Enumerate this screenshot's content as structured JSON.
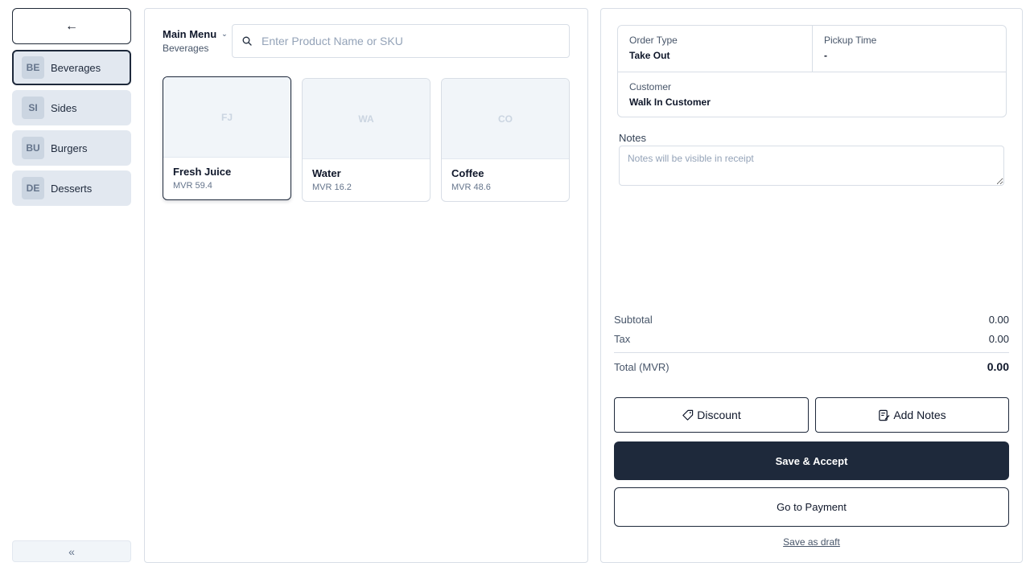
{
  "sidebar": {
    "back_icon": "arrow-left-icon",
    "back_glyph": "←",
    "categories": [
      {
        "badge": "BE",
        "label": "Beverages",
        "active": true
      },
      {
        "badge": "SI",
        "label": "Sides",
        "active": false
      },
      {
        "badge": "BU",
        "label": "Burgers",
        "active": false
      },
      {
        "badge": "DE",
        "label": "Desserts",
        "active": false
      }
    ],
    "collapse_glyph": "«",
    "collapse_icon": "chevrons-left-icon"
  },
  "menu": {
    "title": "Main Menu",
    "subtitle": "Beverages",
    "chevron_glyph": "⌄"
  },
  "search": {
    "placeholder": "Enter Product Name or SKU",
    "value": ""
  },
  "products": [
    {
      "initials": "FJ",
      "name": "Fresh Juice",
      "price": "MVR 59.4",
      "selected": true
    },
    {
      "initials": "WA",
      "name": "Water",
      "price": "MVR 16.2",
      "selected": false
    },
    {
      "initials": "CO",
      "name": "Coffee",
      "price": "MVR 48.6",
      "selected": false
    }
  ],
  "order": {
    "order_type_label": "Order Type",
    "order_type_value": "Take Out",
    "pickup_label": "Pickup Time",
    "pickup_value": "-",
    "customer_label": "Customer",
    "customer_value": "Walk In Customer"
  },
  "notes": {
    "label": "Notes",
    "placeholder": "Notes will be visible in receipt",
    "value": ""
  },
  "summary": {
    "subtotal_label": "Subtotal",
    "subtotal_value": "0.00",
    "tax_label": "Tax",
    "tax_value": "0.00",
    "total_label": "Total (MVR)",
    "total_value": "0.00"
  },
  "actions": {
    "discount": "Discount",
    "add_notes": "Add Notes",
    "save_accept": "Save & Accept",
    "go_to_payment": "Go to Payment",
    "save_draft": "Save as draft"
  },
  "colors": {
    "primary": "#1e293b",
    "category_bg": "#e2e8f0",
    "border": "#d8dee6"
  }
}
